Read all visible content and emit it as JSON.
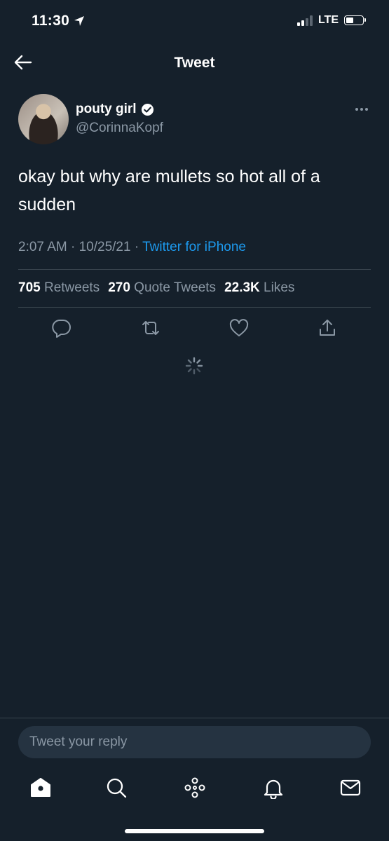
{
  "status_bar": {
    "time": "11:30",
    "network": "LTE"
  },
  "header": {
    "title": "Tweet"
  },
  "tweet": {
    "author_name": "pouty girl",
    "handle": "@CorinnaKopf",
    "text": "okay but why are mullets so hot all of a sudden",
    "time": "2:07 AM",
    "date": "10/25/21",
    "source": "Twitter for iPhone",
    "stats": {
      "retweets_count": "705",
      "retweets_label": "Retweets",
      "quotes_count": "270",
      "quotes_label": "Quote Tweets",
      "likes_count": "22.3K",
      "likes_label": "Likes"
    }
  },
  "reply": {
    "placeholder": "Tweet your reply"
  },
  "icons": {
    "back": "arrow-left-icon",
    "verified": "verified-badge-icon",
    "more": "more-icon",
    "reply": "reply-icon",
    "retweet": "retweet-icon",
    "like": "heart-icon",
    "share": "share-icon",
    "tabs": [
      "home-icon",
      "search-icon",
      "spaces-icon",
      "notifications-icon",
      "messages-icon"
    ]
  },
  "colors": {
    "background": "#15202b",
    "accent": "#1d9bf0",
    "muted": "#8b98a5",
    "divider": "#38444d"
  }
}
